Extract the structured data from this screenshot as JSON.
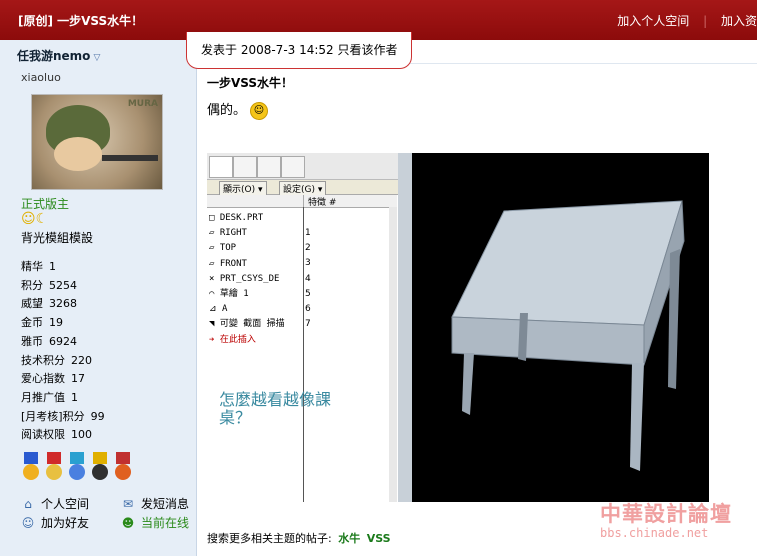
{
  "topbar": {
    "title": "[原创] 一步VSS水牛！",
    "actions": [
      "加入个人空间",
      "加入资"
    ]
  },
  "sidebar": {
    "author": "任我游nemo",
    "subname": "xiaoluo",
    "avatar_label": "MURA",
    "rank": "正式版主",
    "rank_icons": "☺☾",
    "group": "背光模組模設",
    "stats": [
      {
        "k": "精华",
        "v": "1"
      },
      {
        "k": "积分",
        "v": "5254"
      },
      {
        "k": "威望",
        "v": "3268"
      },
      {
        "k": "金币",
        "v": "19"
      },
      {
        "k": "雅币",
        "v": "6924"
      },
      {
        "k": "技术积分",
        "v": "220"
      },
      {
        "k": "爱心指数",
        "v": "17"
      },
      {
        "k": "月推广值",
        "v": "1"
      },
      {
        "k": "[月考核]积分",
        "v": "99"
      },
      {
        "k": "阅读权限",
        "v": "100"
      }
    ],
    "links": {
      "space": "个人空间",
      "sms": "发短消息",
      "friend": "加为好友",
      "online": "当前在线"
    }
  },
  "post": {
    "meta": "发表于  2008-7-3 14:52  只看该作者",
    "title": "一步VSS水牛！",
    "body": "偶的。",
    "footer_prefix": "搜索更多相关主题的帖子:",
    "tags": [
      "水牛",
      "VSS"
    ]
  },
  "screenshot": {
    "menus": [
      "顯示(O) ▾",
      "設定(G) ▾"
    ],
    "col_header": "特徵 #",
    "tree": [
      "□ DESK.PRT",
      "  ▱ RIGHT",
      "  ▱ TOP",
      "  ▱ FRONT",
      "  ⨯ PRT_CSYS_DE",
      "  ⌒ 草繪 1",
      "  ⊿ A",
      "  ◥ 可變 截面 掃描",
      "  ➔ 在此插入"
    ],
    "nums": [
      "1",
      "2",
      "3",
      "4",
      "5",
      "6",
      "7"
    ],
    "note": "怎麼越看越像課桌？"
  },
  "watermark": {
    "line1": "中華設計論壇",
    "line2": "bbs.chinade.net"
  }
}
